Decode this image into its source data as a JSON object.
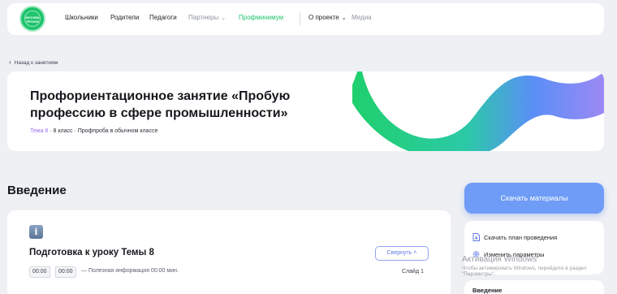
{
  "nav": {
    "logo_line1": "МОСКВА",
    "logo_line2": "ПРОФИ",
    "items": [
      {
        "label": "Школьники"
      },
      {
        "label": "Родители"
      },
      {
        "label": "Педагоги"
      },
      {
        "label": "Партнеры",
        "dropdown": true
      },
      {
        "label": "Профминимум"
      },
      {
        "label": "О проекте",
        "dropdown": true
      },
      {
        "label": "Медиа"
      }
    ]
  },
  "back_link": "Назад к занятиям",
  "hero": {
    "title": "Профориентационное занятие «Пробую профессию в сфере промышленности»",
    "topic": "Тема 8",
    "meta": " · 8 класс · Профпроба в обычном классе"
  },
  "section_title": "Введение",
  "lesson": {
    "info_icon": "info-icon",
    "title": "Подготовка к уроку Темы 8",
    "collapse_label": "Свернуть",
    "time_min": "00:00",
    "time_sec": "00:00",
    "time_note": "— Полезная информация 00:00 мин.",
    "slide": "Слайд 1"
  },
  "sidebar": {
    "download_label": "Скачать материалы",
    "items": [
      {
        "label": "Скачать план проведения",
        "icon": "download-file-icon"
      },
      {
        "label": "Изменить параметры",
        "icon": "settings-icon"
      }
    ],
    "next_label": "Введение"
  },
  "watermark": {
    "line1": "Активация Windows",
    "line2": "Чтобы активировать Windows, перейдите в раздел",
    "line3": "\"Параметры\"."
  },
  "colors": {
    "accent_green": "#20c36a",
    "accent_blue": "#6e9cf6",
    "accent_purple": "#a06ff0"
  }
}
